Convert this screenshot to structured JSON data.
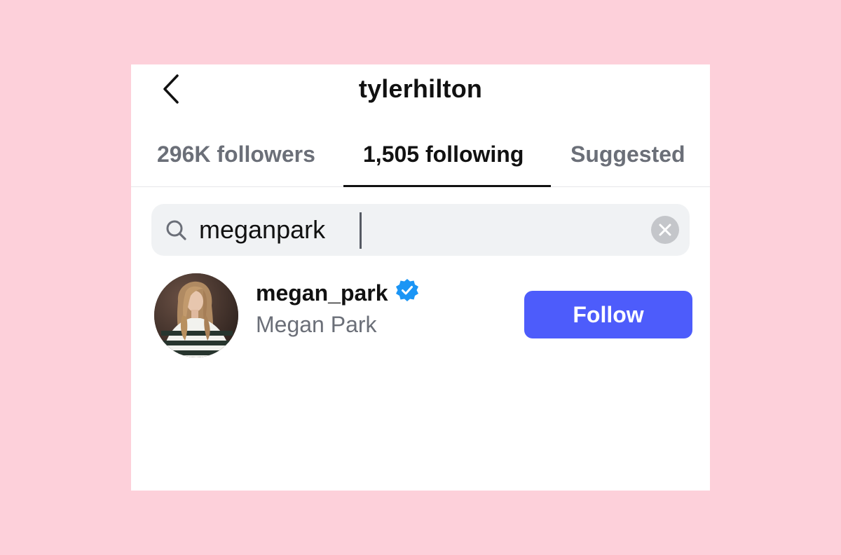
{
  "header": {
    "title": "tylerhilton",
    "back_icon": "chevron-left-icon"
  },
  "tabs": [
    {
      "label": "296K followers",
      "active": false
    },
    {
      "label": "1,505 following",
      "active": true
    },
    {
      "label": "Suggested",
      "active": false
    }
  ],
  "search": {
    "value": "meganpark",
    "icon": "search-icon",
    "clear_icon": "clear-icon"
  },
  "results": [
    {
      "username": "megan_park",
      "full_name": "Megan Park",
      "verified": true,
      "button_label": "Follow"
    }
  ],
  "colors": {
    "background": "#fdd0da",
    "follow_button": "#4d5cfb",
    "verified_badge": "#1b95f5",
    "active_tab": "#111111",
    "inactive_tab": "#6b6f78"
  }
}
